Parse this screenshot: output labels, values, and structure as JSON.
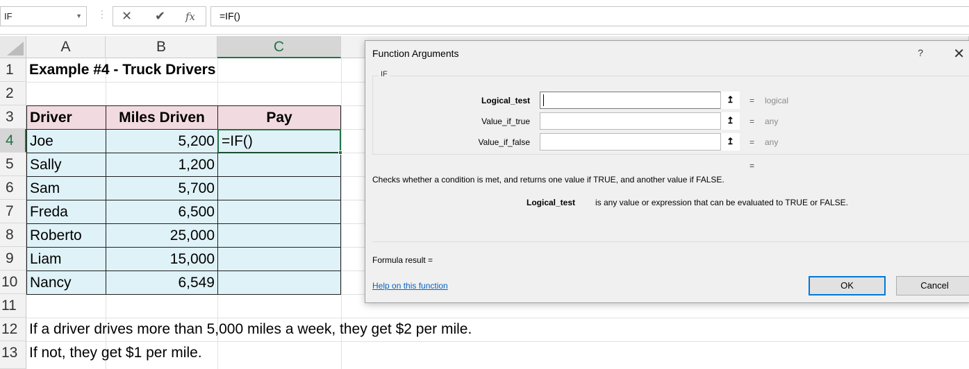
{
  "formula_bar": {
    "name_box": "IF",
    "cancel_symbol": "✕",
    "enter_symbol": "✔",
    "fx_symbol": "fx",
    "formula": "=IF()"
  },
  "columns": [
    "A",
    "B",
    "C"
  ],
  "rows": [
    "1",
    "2",
    "3",
    "4",
    "5",
    "6",
    "7",
    "8",
    "9",
    "10",
    "11",
    "12",
    "13"
  ],
  "sheet": {
    "title": "Example #4 - Truck Drivers",
    "headers": {
      "driver": "Driver",
      "miles": "Miles Driven",
      "pay": "Pay"
    },
    "active_cell_value": "=IF()",
    "drivers": [
      {
        "name": "Joe",
        "miles": "5,200"
      },
      {
        "name": "Sally",
        "miles": "1,200"
      },
      {
        "name": "Sam",
        "miles": "5,700"
      },
      {
        "name": "Freda",
        "miles": "6,500"
      },
      {
        "name": "Roberto",
        "miles": "25,000"
      },
      {
        "name": "Liam",
        "miles": "15,000"
      },
      {
        "name": "Nancy",
        "miles": "6,549"
      }
    ],
    "note1": "If a driver drives more than 5,000 miles a week, they get $2 per mile.",
    "note2": "If not, they get $1 per mile."
  },
  "dialog": {
    "title": "Function Arguments",
    "help_symbol": "?",
    "close_symbol": "✕",
    "function_name": "IF",
    "arguments": [
      {
        "label": "Logical_test",
        "value": "",
        "type": "logical"
      },
      {
        "label": "Value_if_true",
        "value": "",
        "type": "any"
      },
      {
        "label": "Value_if_false",
        "value": "",
        "type": "any"
      }
    ],
    "equals": "=",
    "description": "Checks whether a condition is met, and returns one value if TRUE, and another value if FALSE.",
    "arg_desc_name": "Logical_test",
    "arg_desc_text": "is any value or expression that can be evaluated to TRUE or FALSE.",
    "formula_result": "Formula result =",
    "help_link": "Help on this function",
    "ok": "OK",
    "cancel": "Cancel",
    "ref_button_icon": "upload-arrow-icon"
  },
  "colors": {
    "header_fill": "#f2dbe0",
    "body_fill": "#dff2f7",
    "selection": "#217346",
    "link": "#0563c1",
    "ok_border": "#0078d7"
  }
}
